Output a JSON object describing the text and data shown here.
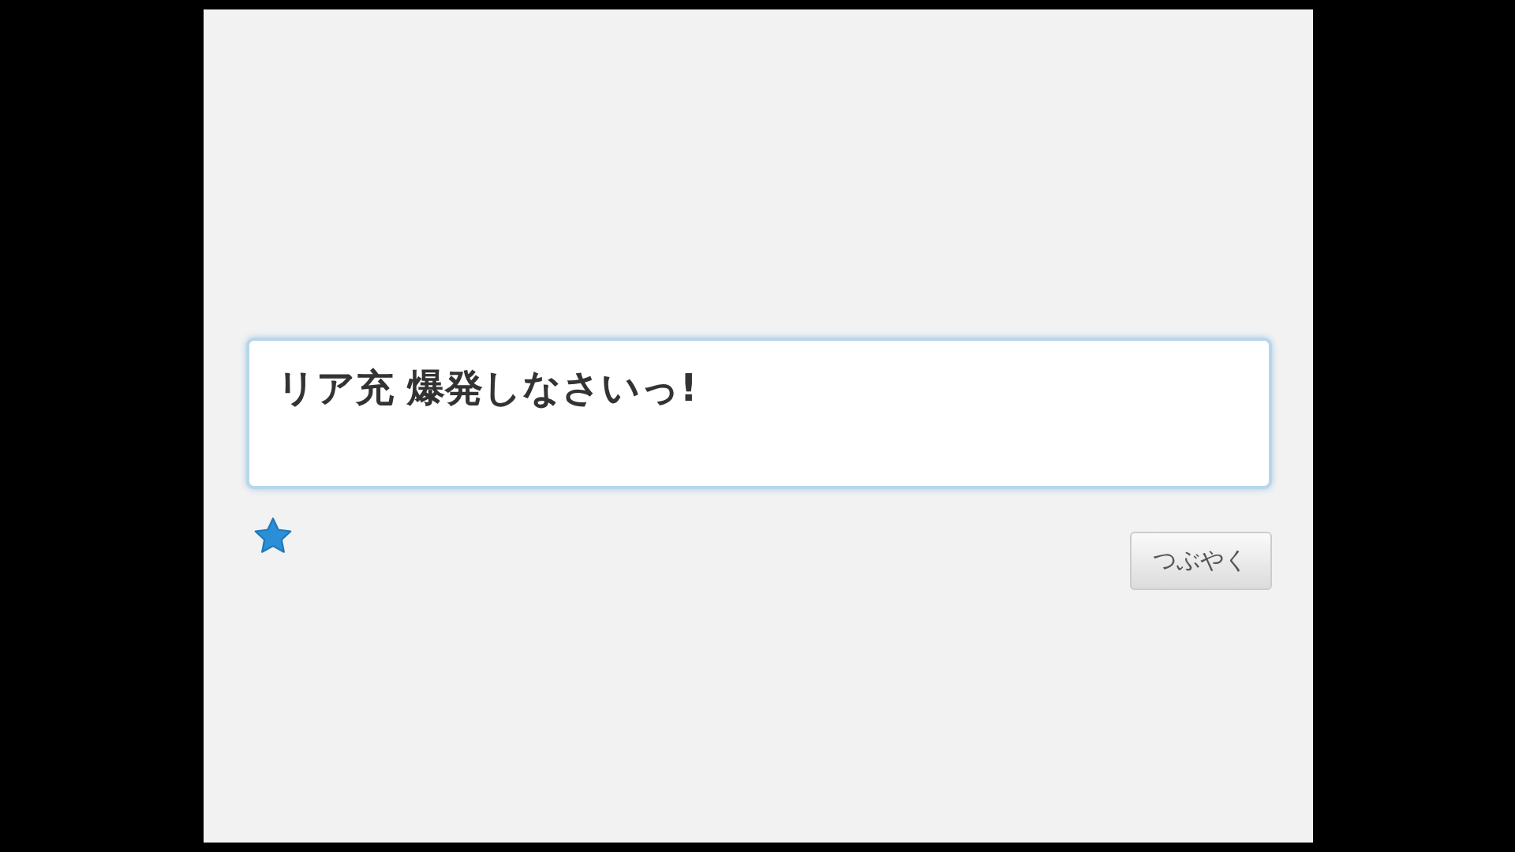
{
  "compose": {
    "text": "リア充 爆発しなさいっ!"
  },
  "button": {
    "label": "つぶやく"
  }
}
